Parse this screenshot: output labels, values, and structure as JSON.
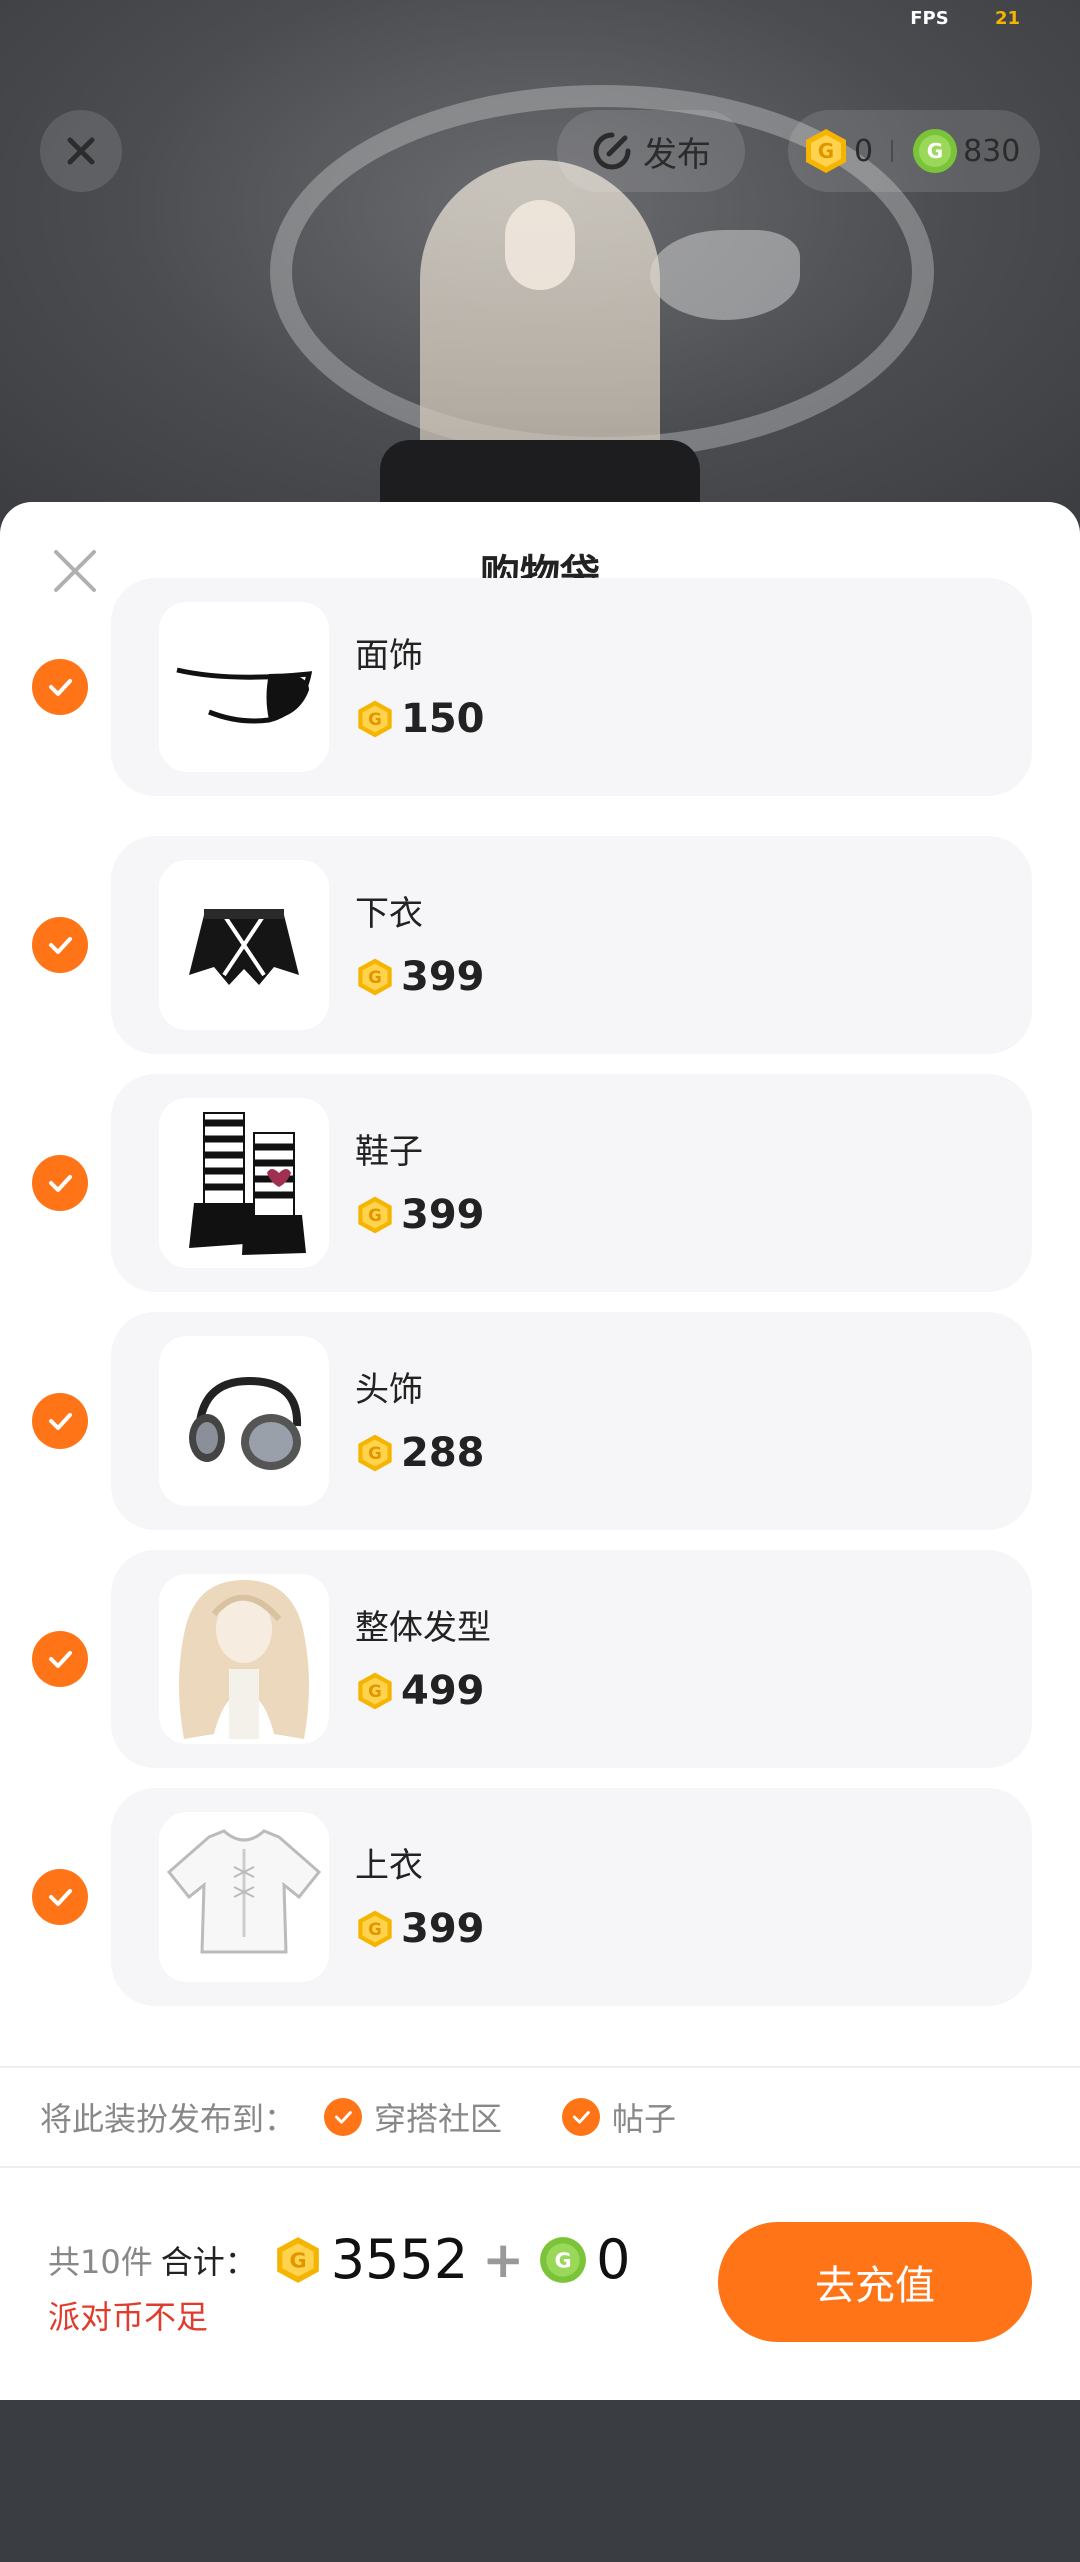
{
  "hud": {
    "fps_label": "FPS",
    "fps_value": "21",
    "publish_label": "发布",
    "gold_coins": "0",
    "green_coins": "830"
  },
  "sheet": {
    "title": "购物袋"
  },
  "items": [
    {
      "name": "面饰",
      "price": "150"
    },
    {
      "name": "下衣",
      "price": "399"
    },
    {
      "name": "鞋子",
      "price": "399"
    },
    {
      "name": "头饰",
      "price": "288"
    },
    {
      "name": "整体发型",
      "price": "499"
    },
    {
      "name": "上衣",
      "price": "399"
    }
  ],
  "publish": {
    "label": "将此装扮发布到：",
    "options": [
      "穿搭社区",
      "帖子"
    ]
  },
  "footer": {
    "count": "共10件",
    "total_label": "合计：",
    "gold_total": "3552",
    "plus": "+",
    "green_total": "0",
    "warning": "派对币不足",
    "recharge": "去充值"
  },
  "colors": {
    "accent": "#ff7417",
    "gold_coin": "#f5b400",
    "green_coin": "#7bc43a",
    "warning": "#e03b2d"
  }
}
